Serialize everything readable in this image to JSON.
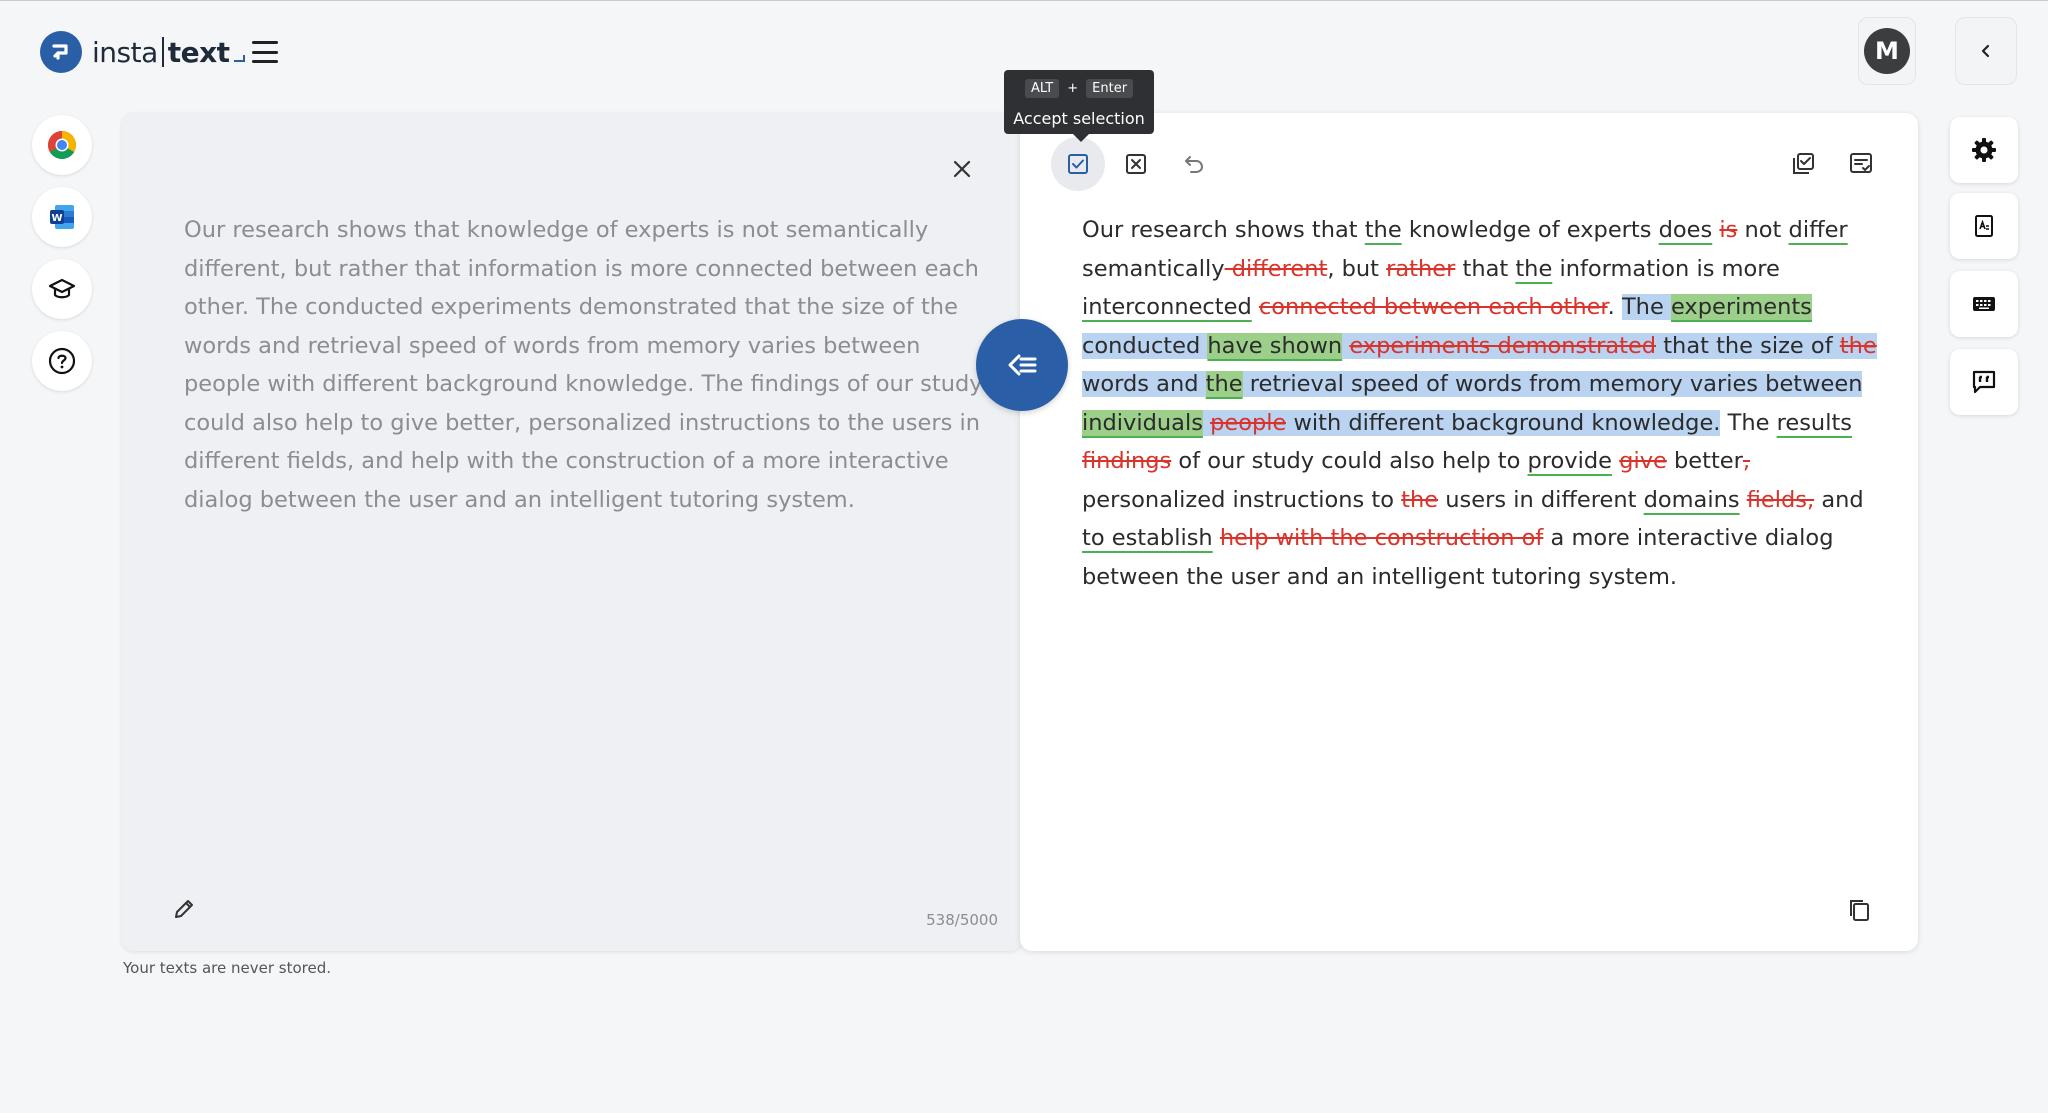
{
  "app": {
    "logo_left": "insta",
    "logo_right": "text",
    "avatar_initial": "M"
  },
  "icons": {
    "rail": [
      "chrome-icon",
      "word-icon",
      "graduation-cap-icon",
      "help-icon"
    ],
    "right_rail": [
      "gear-icon",
      "dictionary-icon",
      "keyboard-icon",
      "feedback-icon"
    ]
  },
  "colors": {
    "brand": "#2a5fa8",
    "insert_underline": "#4caf50",
    "deletion": "#d9342b",
    "selection": "#b9d3f1"
  },
  "source": {
    "text": "Our research shows that knowledge of experts is not semantically different, but rather that information is more connected between each other. The conducted experiments demonstrated that the size of the words and retrieval speed of words from memory varies between people with different background knowledge. The findings of our study could also help to give better, personalized instructions to the users in different fields, and help with the construction of a more interactive dialog between the user and an intelligent tutoring system.",
    "counter": "538/5000",
    "note": "Your texts are never stored."
  },
  "tooltip": {
    "key1": "ALT",
    "plus": "+",
    "key2": "Enter",
    "label": "Accept selection"
  },
  "result": {
    "segments": [
      {
        "t": "Our research shows that ",
        "k": "n"
      },
      {
        "t": "the",
        "k": "ins"
      },
      {
        "t": " knowledge of experts ",
        "k": "n"
      },
      {
        "t": "does",
        "k": "ins"
      },
      {
        "t": " ",
        "k": "n"
      },
      {
        "t": "is",
        "k": "del"
      },
      {
        "t": " not ",
        "k": "n"
      },
      {
        "t": "differ",
        "k": "ins"
      },
      {
        "t": " semantically",
        "k": "n"
      },
      {
        "t": " different",
        "k": "del"
      },
      {
        "t": ", but ",
        "k": "n"
      },
      {
        "t": "rather",
        "k": "del"
      },
      {
        "t": " that ",
        "k": "n"
      },
      {
        "t": "the",
        "k": "ins"
      },
      {
        "t": " information is more ",
        "k": "n"
      },
      {
        "t": "interconnected",
        "k": "ins"
      },
      {
        "t": " ",
        "k": "n"
      },
      {
        "t": "connected between each other",
        "k": "del"
      },
      {
        "t": ". ",
        "k": "n"
      },
      {
        "t": "The ",
        "k": "sel"
      },
      {
        "t": "experiments",
        "k": "sel-ins"
      },
      {
        "t": " conducted ",
        "k": "sel"
      },
      {
        "t": "have shown",
        "k": "sel-ins"
      },
      {
        "t": " ",
        "k": "sel"
      },
      {
        "t": "experiments demonstrated",
        "k": "sel-del"
      },
      {
        "t": " that the size of ",
        "k": "sel"
      },
      {
        "t": "the",
        "k": "sel-del"
      },
      {
        "t": " words and ",
        "k": "sel"
      },
      {
        "t": "the",
        "k": "sel-ins"
      },
      {
        "t": " retrieval speed of words from memory varies between ",
        "k": "sel"
      },
      {
        "t": "individuals",
        "k": "sel-ins"
      },
      {
        "t": " ",
        "k": "sel"
      },
      {
        "t": "people",
        "k": "sel-del"
      },
      {
        "t": " with different background knowledge.",
        "k": "sel"
      },
      {
        "t": " The ",
        "k": "n"
      },
      {
        "t": "results",
        "k": "ins"
      },
      {
        "t": " ",
        "k": "n"
      },
      {
        "t": "findings",
        "k": "del"
      },
      {
        "t": " of our study could also help to ",
        "k": "n"
      },
      {
        "t": "provide",
        "k": "ins"
      },
      {
        "t": " ",
        "k": "n"
      },
      {
        "t": "give",
        "k": "del"
      },
      {
        "t": " better",
        "k": "n"
      },
      {
        "t": ",",
        "k": "del"
      },
      {
        "t": " personalized instructions to ",
        "k": "n"
      },
      {
        "t": "the",
        "k": "del"
      },
      {
        "t": " users in different ",
        "k": "n"
      },
      {
        "t": "domains",
        "k": "ins"
      },
      {
        "t": " ",
        "k": "n"
      },
      {
        "t": "fields,",
        "k": "del"
      },
      {
        "t": " and ",
        "k": "n"
      },
      {
        "t": "to establish",
        "k": "ins"
      },
      {
        "t": " ",
        "k": "n"
      },
      {
        "t": "help with the construction of",
        "k": "del"
      },
      {
        "t": " a more interactive dialog between the user and an intelligent tutoring system.",
        "k": "n"
      }
    ]
  }
}
